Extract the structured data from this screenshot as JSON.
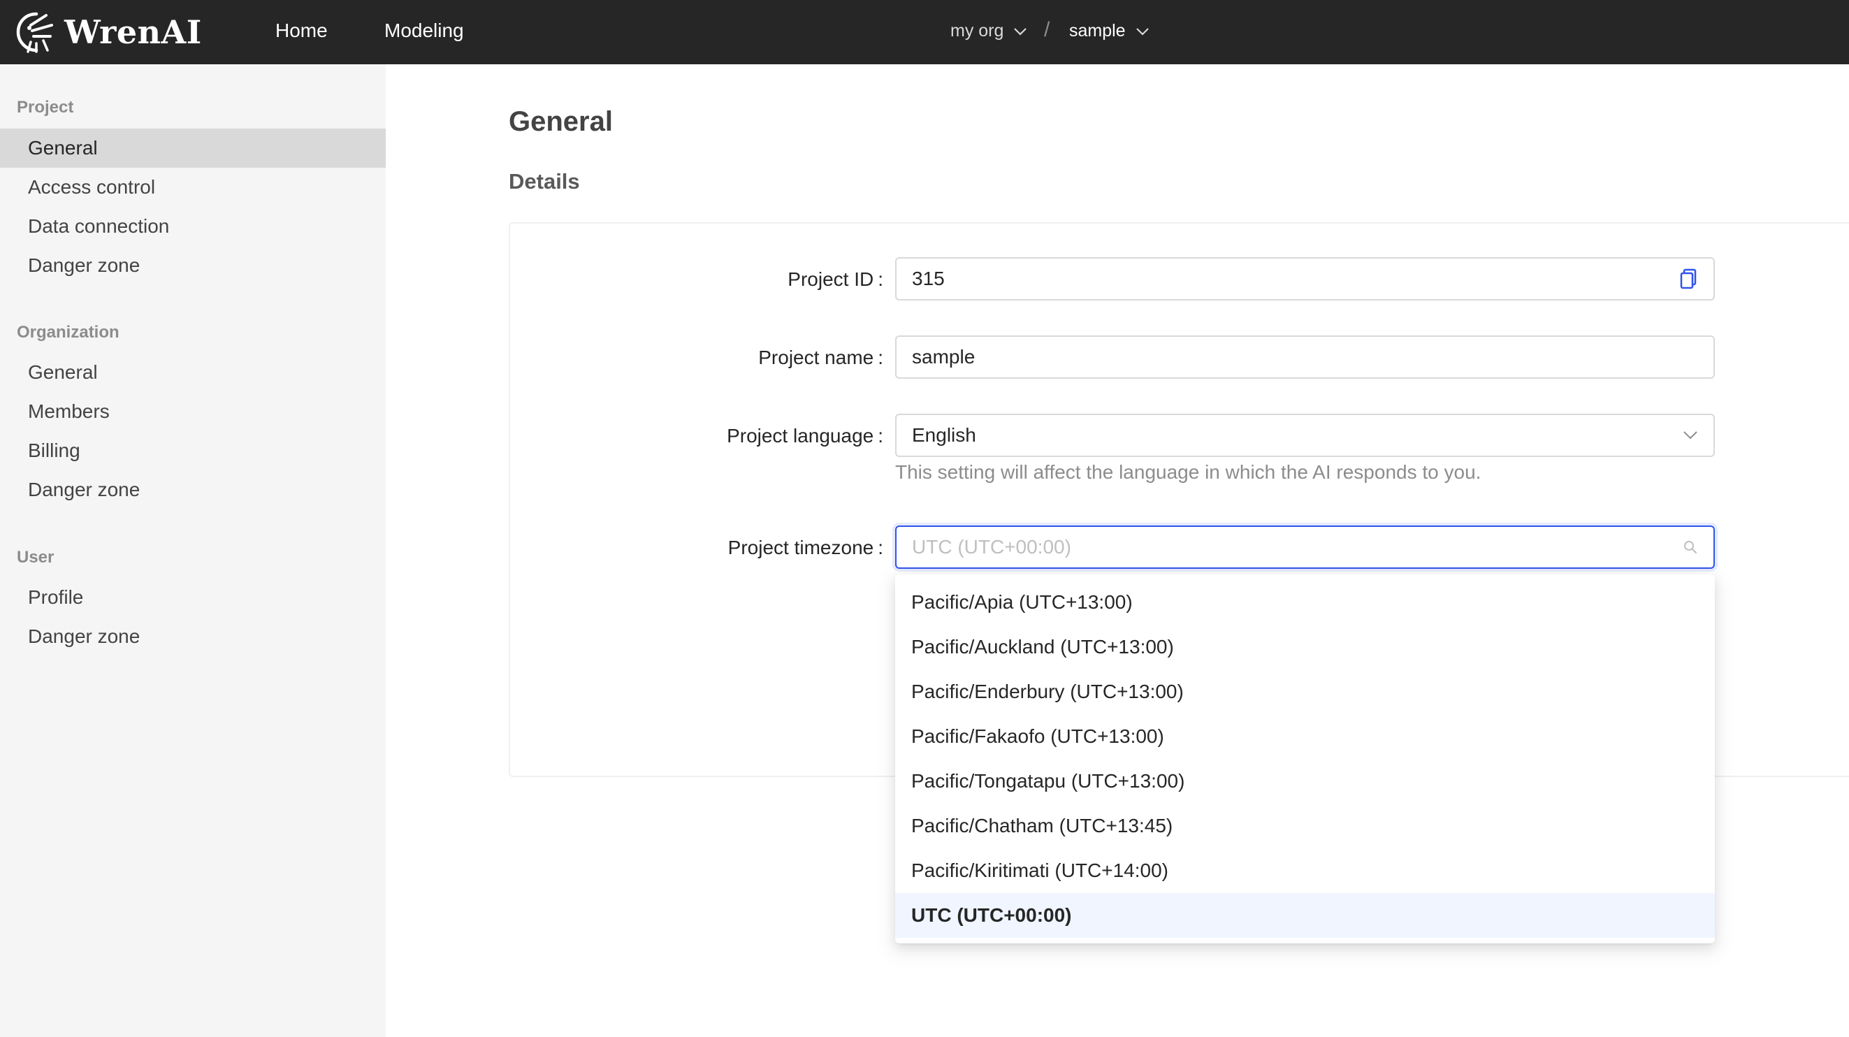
{
  "header": {
    "brand": "WrenAI",
    "nav": [
      "Home",
      "Modeling"
    ],
    "org": "my org",
    "separator": "/",
    "project": "sample"
  },
  "sidebar": {
    "sections": [
      {
        "title": "Project",
        "items": [
          "General",
          "Access control",
          "Data connection",
          "Danger zone"
        ]
      },
      {
        "title": "Organization",
        "items": [
          "General",
          "Members",
          "Billing",
          "Danger zone"
        ]
      },
      {
        "title": "User",
        "items": [
          "Profile",
          "Danger zone"
        ]
      }
    ],
    "active": "Project / General"
  },
  "main": {
    "title": "General",
    "section": "Details",
    "fields": {
      "project_id": {
        "label": "Project ID",
        "value": "315"
      },
      "project_name": {
        "label": "Project name",
        "value": "sample"
      },
      "project_language": {
        "label": "Project language",
        "value": "English",
        "help": "This setting will affect the language in which the AI responds to you."
      },
      "project_timezone": {
        "label": "Project timezone",
        "placeholder": "UTC (UTC+00:00)"
      }
    },
    "colon": ":"
  },
  "timezone_options": [
    "Pacific/Apia (UTC+13:00)",
    "Pacific/Auckland (UTC+13:00)",
    "Pacific/Enderbury (UTC+13:00)",
    "Pacific/Fakaofo (UTC+13:00)",
    "Pacific/Tongatapu (UTC+13:00)",
    "Pacific/Chatham (UTC+13:45)",
    "Pacific/Kiritimati (UTC+14:00)",
    "UTC (UTC+00:00)"
  ],
  "selected_timezone_index": 7,
  "colors": {
    "header_bg": "#262626",
    "sidebar_bg": "#f5f5f5",
    "accent": "#2f54eb",
    "selected_option_bg": "#f0f5ff"
  },
  "icons": [
    "wren-logo-icon",
    "chevron-down-icon",
    "copy-icon",
    "search-icon"
  ]
}
